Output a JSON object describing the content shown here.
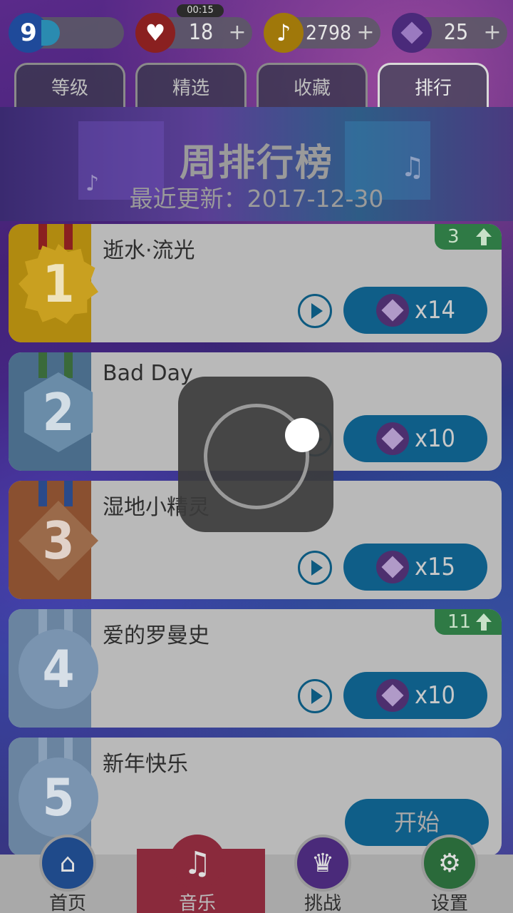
{
  "status": {
    "time": "00:15"
  },
  "resources": {
    "level": {
      "value": "9"
    },
    "hearts": {
      "value": "18",
      "plus": "+"
    },
    "notes": {
      "value": "2798",
      "plus": "+"
    },
    "gems": {
      "value": "25",
      "plus": "+"
    }
  },
  "tabs": [
    {
      "label": "等级"
    },
    {
      "label": "精选"
    },
    {
      "label": "收藏"
    },
    {
      "label": "排行"
    }
  ],
  "banner": {
    "title": "周排行榜",
    "subtitle": "最近更新：2017-12-30"
  },
  "songs": [
    {
      "rank": "1",
      "title": "逝水·流光",
      "price": "x14",
      "rank_change": "3",
      "medal_color": "#c9a020"
    },
    {
      "rank": "2",
      "title": "Bad Day",
      "price": "x10",
      "rank_change": "",
      "medal_color": "#6a8ca8"
    },
    {
      "rank": "3",
      "title": "湿地小精灵",
      "price": "x15",
      "rank_change": "",
      "medal_color": "#9a6a4a"
    },
    {
      "rank": "4",
      "title": "爱的罗曼史",
      "price": "x10",
      "rank_change": "11",
      "medal_color": "#7a94b0"
    },
    {
      "rank": "5",
      "title": "新年快乐",
      "start_label": "开始",
      "medal_color": "#7a94b0"
    }
  ],
  "bottom_nav": [
    {
      "label": "首页",
      "icon": "home-icon"
    },
    {
      "label": "音乐",
      "icon": "music-note-icon"
    },
    {
      "label": "挑战",
      "icon": "trophy-icon"
    },
    {
      "label": "设置",
      "icon": "gear-icon"
    }
  ],
  "colors": {
    "accent_blue": "#0f5e88",
    "rank_up_green": "#2f7a45",
    "music_tab_red": "#8a2a3c"
  }
}
